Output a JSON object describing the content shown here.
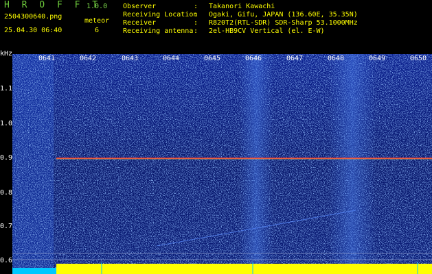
{
  "header": {
    "app_name": "H R O F F T",
    "version": "1.0.0",
    "file_name": "2504300640.png",
    "meteor_label": "meteor",
    "timestamp": "25.04.30 06:40",
    "meteor_count": "6",
    "info": [
      {
        "label": "Observer",
        "value": "Takanori Kawachi"
      },
      {
        "label": "Receiving Location",
        "value": "Ogaki, Gifu, JAPAN (136.60E, 35.35N)"
      },
      {
        "label": "Receiver",
        "value": "R820T2(RTL-SDR) SDR-Sharp 53.1000MHz"
      },
      {
        "label": "Receiving antenna",
        "value": "2el-HB9CV Vertical (el. E-W)"
      }
    ],
    "separator": ":"
  },
  "axis": {
    "y_unit": "kHz",
    "y_ticks": [
      "1.1",
      "1.0",
      "0.9",
      "0.8",
      "0.7",
      "0.6"
    ],
    "x_ticks": [
      "0641",
      "0642",
      "0643",
      "0644",
      "0645",
      "0646",
      "0647",
      "0648",
      "0649",
      "0650"
    ]
  },
  "colors": {
    "background": "#000000",
    "waterfall": "#0a1a6e",
    "noise": "#3d6fe0",
    "carrier": "#ff3030",
    "header_text": "#ffff00",
    "logo": "#6ecb3c",
    "baseline": "#ffff00",
    "cyan": "#00c8ff"
  }
}
